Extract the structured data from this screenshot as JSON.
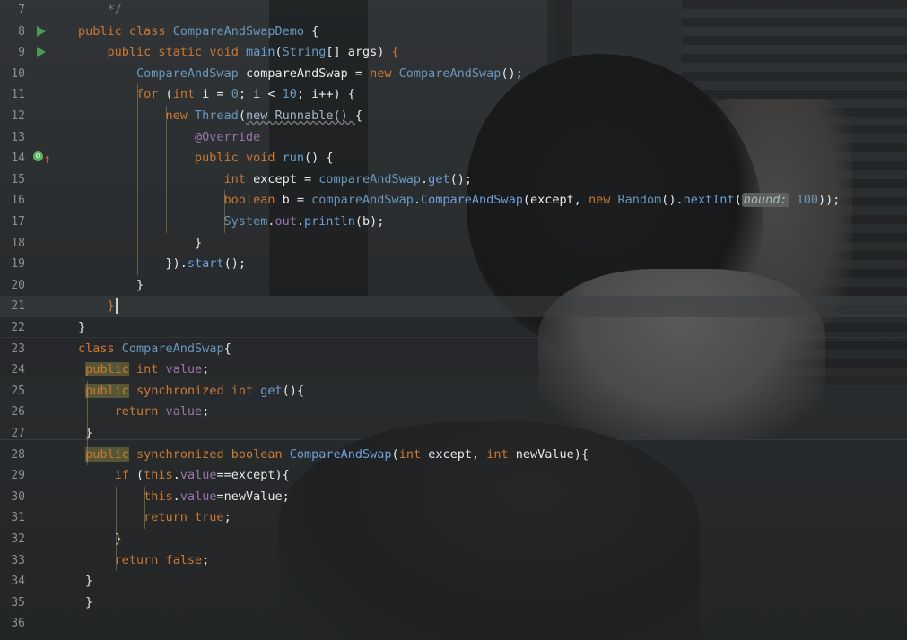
{
  "lines": [
    {
      "num": "7",
      "tokens": [
        {
          "t": "    */",
          "c": "cm"
        }
      ]
    },
    {
      "num": "8",
      "run": true,
      "tokens": [
        {
          "t": "public ",
          "c": "kw"
        },
        {
          "t": "class ",
          "c": "kw"
        },
        {
          "t": "CompareAndSwapDemo ",
          "c": "cls"
        },
        {
          "t": "{",
          "c": "plain"
        }
      ]
    },
    {
      "num": "9",
      "run": true,
      "tokens": [
        {
          "t": "    public ",
          "c": "kw"
        },
        {
          "t": "static ",
          "c": "kw"
        },
        {
          "t": "void ",
          "c": "kw"
        },
        {
          "t": "main",
          "c": "mth"
        },
        {
          "t": "(",
          "c": "plain"
        },
        {
          "t": "String",
          "c": "cls"
        },
        {
          "t": "[] args) ",
          "c": "plain"
        },
        {
          "t": "{",
          "c": "kw"
        }
      ]
    },
    {
      "num": "10",
      "tokens": [
        {
          "t": "        CompareAndSwap ",
          "c": "cls"
        },
        {
          "t": "compareAndSwap = ",
          "c": "plain"
        },
        {
          "t": "new ",
          "c": "kw"
        },
        {
          "t": "CompareAndSwap",
          "c": "cls"
        },
        {
          "t": "();",
          "c": "plain"
        }
      ]
    },
    {
      "num": "11",
      "tokens": [
        {
          "t": "        for ",
          "c": "kw"
        },
        {
          "t": "(",
          "c": "plain"
        },
        {
          "t": "int ",
          "c": "kw"
        },
        {
          "t": "i = ",
          "c": "plain"
        },
        {
          "t": "0",
          "c": "num"
        },
        {
          "t": "; i < ",
          "c": "plain"
        },
        {
          "t": "10",
          "c": "num"
        },
        {
          "t": "; i++) {",
          "c": "plain"
        }
      ]
    },
    {
      "num": "12",
      "tokens": [
        {
          "t": "            new ",
          "c": "kw"
        },
        {
          "t": "Thread",
          "c": "cls"
        },
        {
          "t": "(",
          "c": "plain"
        },
        {
          "t": "new Runnable() ",
          "c": "wavy"
        },
        {
          "t": "{",
          "c": "plain"
        }
      ]
    },
    {
      "num": "13",
      "tokens": [
        {
          "t": "                @Override",
          "c": "fld"
        }
      ]
    },
    {
      "num": "14",
      "override": true,
      "tokens": [
        {
          "t": "                public ",
          "c": "kw"
        },
        {
          "t": "void ",
          "c": "kw"
        },
        {
          "t": "run",
          "c": "mth"
        },
        {
          "t": "() {",
          "c": "plain"
        }
      ]
    },
    {
      "num": "15",
      "tokens": [
        {
          "t": "                    int ",
          "c": "kw"
        },
        {
          "t": "except = ",
          "c": "plain"
        },
        {
          "t": "compareAndSwap",
          "c": "cls"
        },
        {
          "t": ".",
          "c": "plain"
        },
        {
          "t": "get",
          "c": "mth"
        },
        {
          "t": "();",
          "c": "plain"
        }
      ]
    },
    {
      "num": "16",
      "tokens": [
        {
          "t": "                    boolean ",
          "c": "kw"
        },
        {
          "t": "b = ",
          "c": "plain"
        },
        {
          "t": "compareAndSwap",
          "c": "cls"
        },
        {
          "t": ".",
          "c": "plain"
        },
        {
          "t": "CompareAndSwap",
          "c": "mth"
        },
        {
          "t": "(except, ",
          "c": "plain"
        },
        {
          "t": "new ",
          "c": "kw"
        },
        {
          "t": "Random",
          "c": "cls"
        },
        {
          "t": "().",
          "c": "plain"
        },
        {
          "t": "nextInt",
          "c": "mth"
        },
        {
          "t": "(",
          "c": "plain"
        },
        {
          "t": "bound:",
          "c": "hint"
        },
        {
          "t": " 100",
          "c": "num"
        },
        {
          "t": "));",
          "c": "plain"
        }
      ]
    },
    {
      "num": "17",
      "tokens": [
        {
          "t": "                    System",
          "c": "cls"
        },
        {
          "t": ".",
          "c": "plain"
        },
        {
          "t": "out",
          "c": "fld"
        },
        {
          "t": ".",
          "c": "plain"
        },
        {
          "t": "println",
          "c": "mth"
        },
        {
          "t": "(b);",
          "c": "plain"
        }
      ]
    },
    {
      "num": "18",
      "tokens": [
        {
          "t": "                }",
          "c": "plain"
        }
      ]
    },
    {
      "num": "19",
      "tokens": [
        {
          "t": "            }).",
          "c": "plain"
        },
        {
          "t": "start",
          "c": "mth"
        },
        {
          "t": "();",
          "c": "plain"
        }
      ]
    },
    {
      "num": "20",
      "tokens": [
        {
          "t": "        }",
          "c": "plain"
        }
      ]
    },
    {
      "num": "21",
      "current": true,
      "caret": true,
      "tokens": [
        {
          "t": "    }",
          "c": "kw"
        }
      ]
    },
    {
      "num": "22",
      "tokens": [
        {
          "t": "}",
          "c": "plain"
        }
      ]
    },
    {
      "num": "23",
      "tokens": [
        {
          "t": "class ",
          "c": "kw"
        },
        {
          "t": "CompareAndSwap",
          "c": "cls"
        },
        {
          "t": "{",
          "c": "plain"
        }
      ]
    },
    {
      "num": "24",
      "tokens": [
        {
          "t": " ",
          "c": "plain"
        },
        {
          "t": "public",
          "c": "hl"
        },
        {
          "t": " int ",
          "c": "kw"
        },
        {
          "t": "value",
          "c": "fld"
        },
        {
          "t": ";",
          "c": "plain"
        }
      ]
    },
    {
      "num": "25",
      "tokens": [
        {
          "t": " ",
          "c": "plain"
        },
        {
          "t": "public",
          "c": "hl"
        },
        {
          "t": " synchronized ",
          "c": "kw"
        },
        {
          "t": "int ",
          "c": "kw"
        },
        {
          "t": "get",
          "c": "mth"
        },
        {
          "t": "(){",
          "c": "plain"
        }
      ]
    },
    {
      "num": "26",
      "tokens": [
        {
          "t": "     return ",
          "c": "kw"
        },
        {
          "t": "value",
          "c": "fld"
        },
        {
          "t": ";",
          "c": "plain"
        }
      ]
    },
    {
      "num": "27",
      "tokens": [
        {
          "t": " }",
          "c": "plain"
        }
      ]
    },
    {
      "num": "28",
      "tokens": [
        {
          "t": " ",
          "c": "plain"
        },
        {
          "t": "public",
          "c": "hl"
        },
        {
          "t": " synchronized ",
          "c": "kw"
        },
        {
          "t": "boolean ",
          "c": "kw"
        },
        {
          "t": "CompareAndSwap",
          "c": "mth"
        },
        {
          "t": "(",
          "c": "plain"
        },
        {
          "t": "int ",
          "c": "kw"
        },
        {
          "t": "except, ",
          "c": "plain"
        },
        {
          "t": "int ",
          "c": "kw"
        },
        {
          "t": "newValue){",
          "c": "plain"
        }
      ]
    },
    {
      "num": "29",
      "tokens": [
        {
          "t": "     if ",
          "c": "kw"
        },
        {
          "t": "(",
          "c": "plain"
        },
        {
          "t": "this",
          "c": "kw"
        },
        {
          "t": ".",
          "c": "plain"
        },
        {
          "t": "value",
          "c": "fld"
        },
        {
          "t": "==except){",
          "c": "plain"
        }
      ]
    },
    {
      "num": "30",
      "tokens": [
        {
          "t": "         this",
          "c": "kw"
        },
        {
          "t": ".",
          "c": "plain"
        },
        {
          "t": "value",
          "c": "fld"
        },
        {
          "t": "=newValue;",
          "c": "plain"
        }
      ]
    },
    {
      "num": "31",
      "tokens": [
        {
          "t": "         return ",
          "c": "kw"
        },
        {
          "t": "true",
          "c": "kw"
        },
        {
          "t": ";",
          "c": "plain"
        }
      ]
    },
    {
      "num": "32",
      "tokens": [
        {
          "t": "     }",
          "c": "plain"
        }
      ]
    },
    {
      "num": "33",
      "tokens": [
        {
          "t": "     return ",
          "c": "kw"
        },
        {
          "t": "false",
          "c": "kw"
        },
        {
          "t": ";",
          "c": "plain"
        }
      ]
    },
    {
      "num": "34",
      "tokens": [
        {
          "t": " }",
          "c": "plain"
        }
      ]
    },
    {
      "num": "35",
      "tokens": [
        {
          "t": " }",
          "c": "plain"
        }
      ]
    },
    {
      "num": "36",
      "tokens": []
    }
  ]
}
